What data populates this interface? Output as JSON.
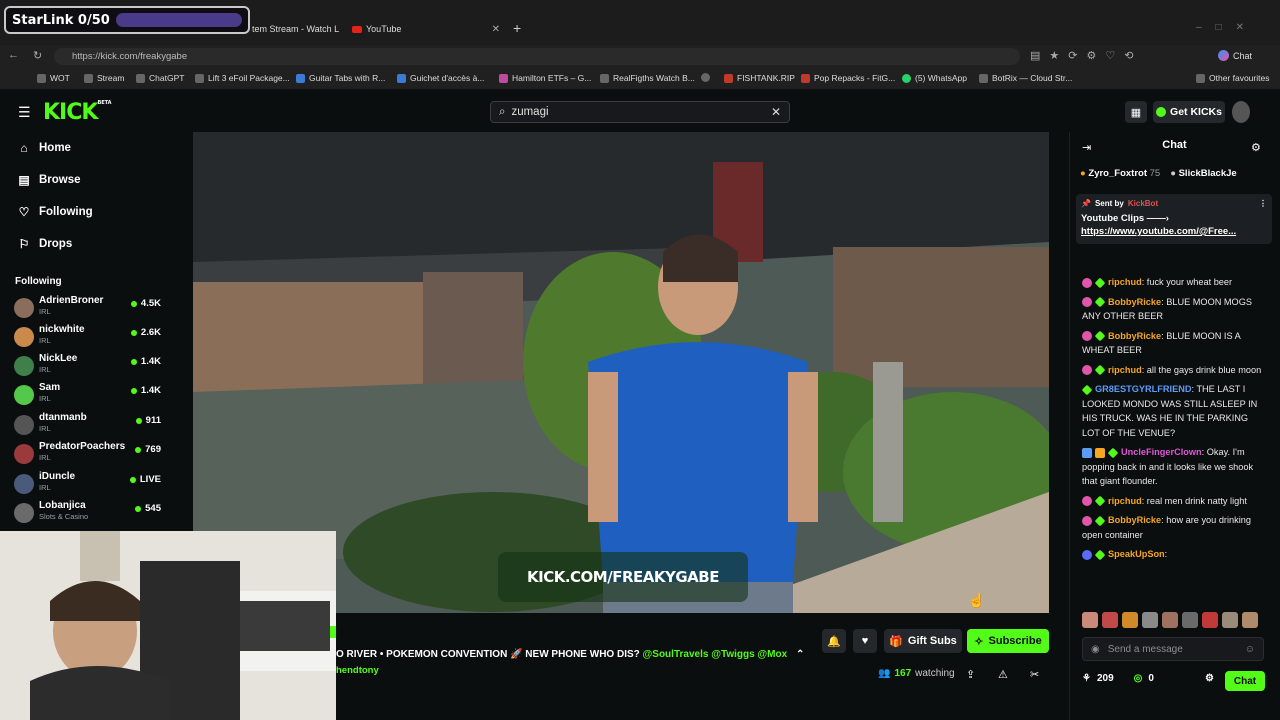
{
  "overlay": {
    "starlink_label": "StarLink 0/50"
  },
  "browser": {
    "tabs": [
      {
        "label": "tem Stream - Watch L"
      },
      {
        "label": "YouTube"
      }
    ],
    "new_tab_glyph": "+",
    "url": "https://kick.com/freakygabe",
    "chat_label": "Chat",
    "bookmarks": [
      "WOT",
      "Stream",
      "ChatGPT",
      "Lift 3 eFoil Package...",
      "Guitar Tabs with R...",
      "Guichet d'accès à...",
      "Hamilton ETFs – G...",
      "RealFigths Watch B...",
      "",
      "FISHTANK.RIP",
      "Pop Repacks - FitG...",
      "(5) WhatsApp",
      "BotRix — Cloud Str..."
    ],
    "other_favourites": "Other favourites"
  },
  "header": {
    "logo": "KICK",
    "logo_sup": "BETA",
    "search_value": "zumagi",
    "get_kicks": "Get KICKs"
  },
  "sidebar": {
    "nav": [
      {
        "label": "Home",
        "icon": "home-icon"
      },
      {
        "label": "Browse",
        "icon": "browse-icon"
      },
      {
        "label": "Following",
        "icon": "heart-icon"
      },
      {
        "label": "Drops",
        "icon": "drops-icon"
      }
    ],
    "following_heading": "Following",
    "following": [
      {
        "name": "AdrienBroner",
        "category": "IRL",
        "viewers": "4.5K",
        "color": "#8a6d5a"
      },
      {
        "name": "nickwhite",
        "category": "IRL",
        "viewers": "2.6K",
        "color": "#c98a4b"
      },
      {
        "name": "NickLee",
        "category": "IRL",
        "viewers": "1.4K",
        "color": "#3f7f4a"
      },
      {
        "name": "Sam",
        "category": "IRL",
        "viewers": "1.4K",
        "color": "#53c84a"
      },
      {
        "name": "dtanmanb",
        "category": "IRL",
        "viewers": "911",
        "color": "#555"
      },
      {
        "name": "PredatorPoachers",
        "category": "IRL",
        "viewers": "769",
        "color": "#9a3a3a"
      },
      {
        "name": "iDuncle",
        "category": "IRL",
        "viewers": "LIVE",
        "color": "#4a5a7a"
      },
      {
        "name": "Lobanjica",
        "category": "Slots & Casino",
        "viewers": "545",
        "color": "#6a6a6a"
      }
    ]
  },
  "video": {
    "watermark": "KICK.COM/FREAKYGABE"
  },
  "stream": {
    "title": "O RIVER • POKEMON CONVENTION 🚀 NEW PHONE WHO DIS?",
    "title_tags": "@SoulTravels @Twiggs @Mox",
    "subtitle": "hendtony",
    "gift_subs": "Gift Subs",
    "subscribe": "Subscribe",
    "watching_count": "167",
    "watching_label": "watching"
  },
  "chat": {
    "title": "Chat",
    "gifters": [
      {
        "name": "Zyro_Foxtrot",
        "count": "75"
      },
      {
        "name": "SlickBlackJe",
        "count": ""
      }
    ],
    "pinned": {
      "sent_by": "Sent by",
      "bot": "KickBot",
      "line1": "Youtube Clips ——›",
      "link": "https://www.youtube.com/@Free..."
    },
    "messages": [
      {
        "user": "ripchud",
        "color": "#f5a623",
        "text": "fuck your wheat beer"
      },
      {
        "user": "BobbyRicke",
        "color": "#f5a623",
        "text": "BLUE MOON MOGS ANY OTHER BEER"
      },
      {
        "user": "BobbyRicke",
        "color": "#f5a623",
        "text": "BLUE MOON IS A WHEAT BEER"
      },
      {
        "user": "ripchud",
        "color": "#f5a623",
        "text": "all the gays drink blue moon"
      },
      {
        "user": "GR8ESTGYRLFRIEND",
        "color": "#5b9cf7",
        "text": "THE LAST I LOOKED MONDO WAS STILL ASLEEP IN HIS TRUCK. WAS HE IN THE PARKING LOT OF THE VENUE?"
      },
      {
        "user": "UncleFingerClown",
        "color": "#e056d8",
        "text": "Okay. I'm popping back in and it looks like we shook that giant flounder."
      },
      {
        "user": "ripchud",
        "color": "#f5a623",
        "text": "real men drink natty light"
      },
      {
        "user": "BobbyRicke",
        "color": "#f5a623",
        "text": "how are you drinking open container"
      },
      {
        "user": "SpeakUpSon",
        "color": "#f5a623",
        "text": ""
      }
    ],
    "placeholder": "Send a message",
    "points": "209",
    "kicks": "0",
    "send_label": "Chat"
  }
}
